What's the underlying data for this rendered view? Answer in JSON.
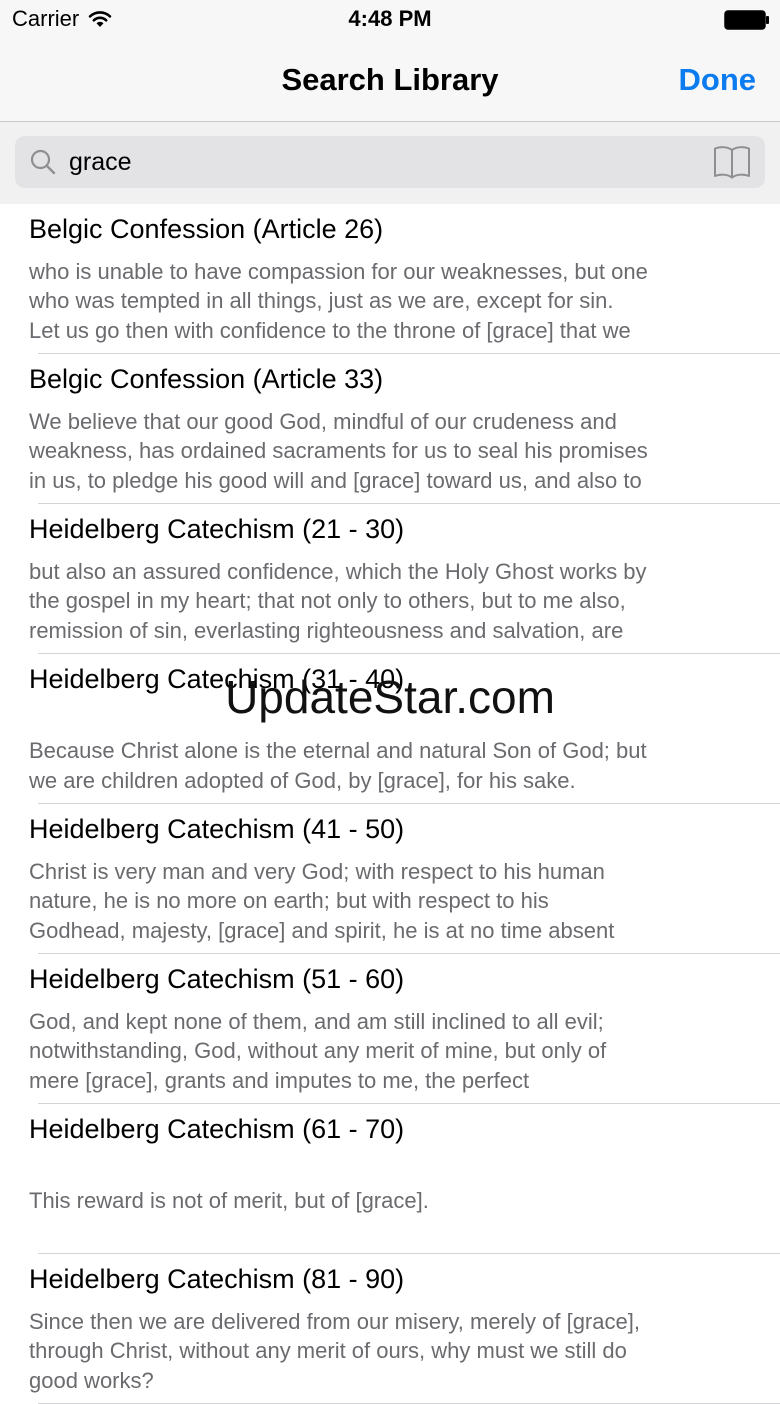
{
  "status_bar": {
    "carrier": "Carrier",
    "time": "4:48 PM"
  },
  "nav": {
    "title": "Search Library",
    "done_label": "Done",
    "accent_color": "#0a7cf0"
  },
  "search": {
    "value": "grace",
    "icons": [
      "search-icon",
      "book-icon"
    ]
  },
  "results": [
    {
      "title": "Belgic Confession (Article 26)",
      "snippet": "who is unable to have compassion for our weaknesses, but one\nwho was tempted in all things, just as we are, except for sin.\nLet us go then with confidence to the throne of [grace] that we"
    },
    {
      "title": "Belgic Confession (Article 33)",
      "snippet": "We believe that our good God, mindful of our crudeness and\nweakness, has ordained sacraments for us to seal his promises\nin us, to pledge his good will and [grace] toward us, and also to"
    },
    {
      "title": "Heidelberg Catechism (21 - 30)",
      "snippet": "but also an assured confidence, which the Holy Ghost works by\nthe gospel in my heart; that not only to others, but to me also,\nremission of sin, everlasting righteousness and salvation, are"
    },
    {
      "title": "Heidelberg Catechism (31 - 40)",
      "snippet": "\nBecause Christ alone is the eternal and natural Son of God; but\nwe are children adopted of God, by [grace], for his sake."
    },
    {
      "title": "Heidelberg Catechism (41 - 50)",
      "snippet": "Christ is very man and very God; with respect to his human\nnature, he is no more on earth; but with respect to his\nGodhead, majesty, [grace] and spirit, he is at no time absent"
    },
    {
      "title": "Heidelberg Catechism (51 - 60)",
      "snippet": "God, and kept none of them, and am still inclined to all evil;\nnotwithstanding, God, without any merit of mine, but only of\nmere [grace], grants and imputes to me, the perfect"
    },
    {
      "title": "Heidelberg Catechism (61 - 70)",
      "snippet": "\nThis reward is not of merit, but of [grace]."
    },
    {
      "title": "Heidelberg Catechism (81 - 90)",
      "snippet": "Since then we are delivered from our misery, merely of [grace],\nthrough Christ, without any merit of ours, why must we still do\ngood works?"
    }
  ],
  "watermark": "UpdateStar.com"
}
